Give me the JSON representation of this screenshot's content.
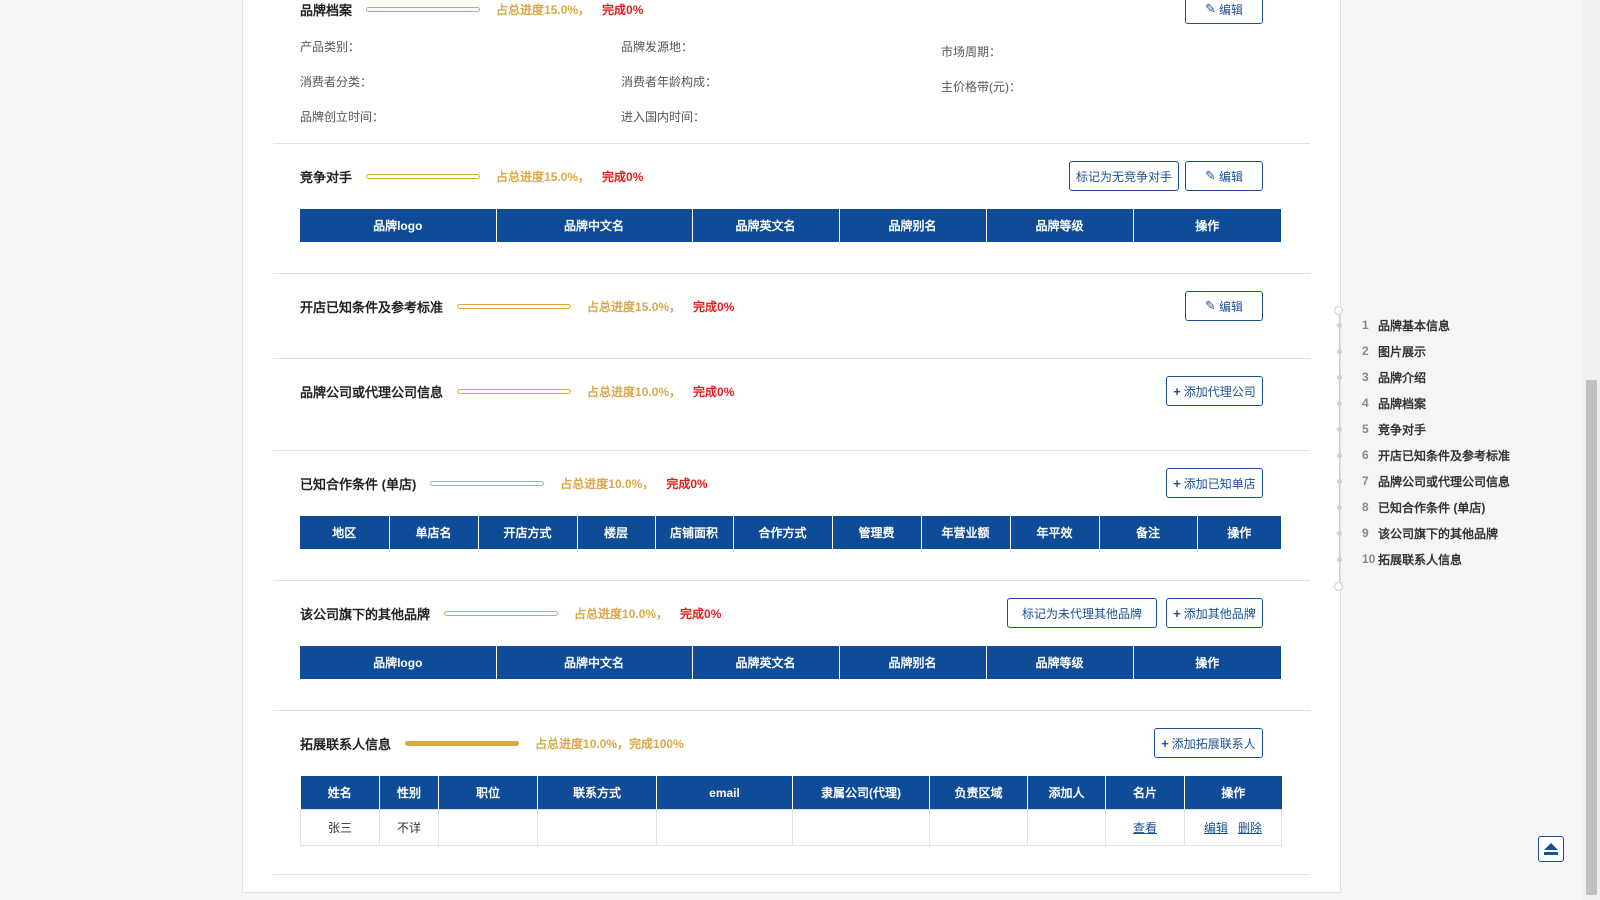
{
  "labels": {
    "edit": "编辑"
  },
  "sec_archive": {
    "title": "品牌档案",
    "pct": "占总进度15.0%，",
    "done": "完成0%",
    "fields": {
      "category": "产品类别：",
      "origin": "品牌发源地：",
      "cycle": "市场周期：",
      "consumer_type": "消费者分类：",
      "age": "消费者年龄构成：",
      "price_band": "主价格带(元)：",
      "founded": "品牌创立时间：",
      "entry": "进入国内时间："
    }
  },
  "sec_competitor": {
    "title": "竞争对手",
    "pct": "占总进度15.0%，",
    "done": "完成0%",
    "mark_btn": "标记为无竞争对手",
    "headers": [
      "品牌logo",
      "品牌中文名",
      "品牌英文名",
      "品牌别名",
      "品牌等级",
      "操作"
    ]
  },
  "sec_store": {
    "title": "开店已知条件及参考标准",
    "pct": "占总进度15.0%，",
    "done": "完成0%"
  },
  "sec_agent": {
    "title": "品牌公司或代理公司信息",
    "pct": "占总进度10.0%，",
    "done": "完成0%",
    "add_btn": "添加代理公司"
  },
  "sec_coop": {
    "title": "已知合作条件 (单店)",
    "pct": "占总进度10.0%，",
    "done": "完成0%",
    "add_btn": "添加已知单店",
    "headers": [
      "地区",
      "单店名",
      "开店方式",
      "楼层",
      "店铺面积",
      "合作方式",
      "管理费",
      "年营业额",
      "年平效",
      "备注",
      "操作"
    ]
  },
  "sec_other": {
    "title": "该公司旗下的其他品牌",
    "pct": "占总进度10.0%，",
    "done": "完成0%",
    "mark_btn": "标记为未代理其他品牌",
    "add_btn": "添加其他品牌",
    "headers": [
      "品牌logo",
      "品牌中文名",
      "品牌英文名",
      "品牌别名",
      "品牌等级",
      "操作"
    ]
  },
  "sec_contact": {
    "title": "拓展联系人信息",
    "pct": "占总进度10.0%，",
    "done": "完成100%",
    "add_btn": "添加拓展联系人",
    "headers": [
      "姓名",
      "性别",
      "职位",
      "联系方式",
      "email",
      "隶属公司(代理)",
      "负责区域",
      "添加人",
      "名片",
      "操作"
    ],
    "row": {
      "name": "张三",
      "gender": "不详",
      "view": "查看",
      "edit": "编辑",
      "delete": "删除"
    }
  },
  "nav": [
    {
      "num": "1",
      "label": "品牌基本信息"
    },
    {
      "num": "2",
      "label": "图片展示"
    },
    {
      "num": "3",
      "label": "品牌介绍"
    },
    {
      "num": "4",
      "label": "品牌档案"
    },
    {
      "num": "5",
      "label": "竞争对手"
    },
    {
      "num": "6",
      "label": "开店已知条件及参考标准"
    },
    {
      "num": "7",
      "label": "品牌公司或代理公司信息"
    },
    {
      "num": "8",
      "label": "已知合作条件 (单店)"
    },
    {
      "num": "9",
      "label": "该公司旗下的其他品牌"
    },
    {
      "num": "10",
      "label": "拓展联系人信息"
    }
  ],
  "colors": {
    "primary": "#0f4c97",
    "gold": "#d9a84a",
    "red": "#e02020"
  }
}
